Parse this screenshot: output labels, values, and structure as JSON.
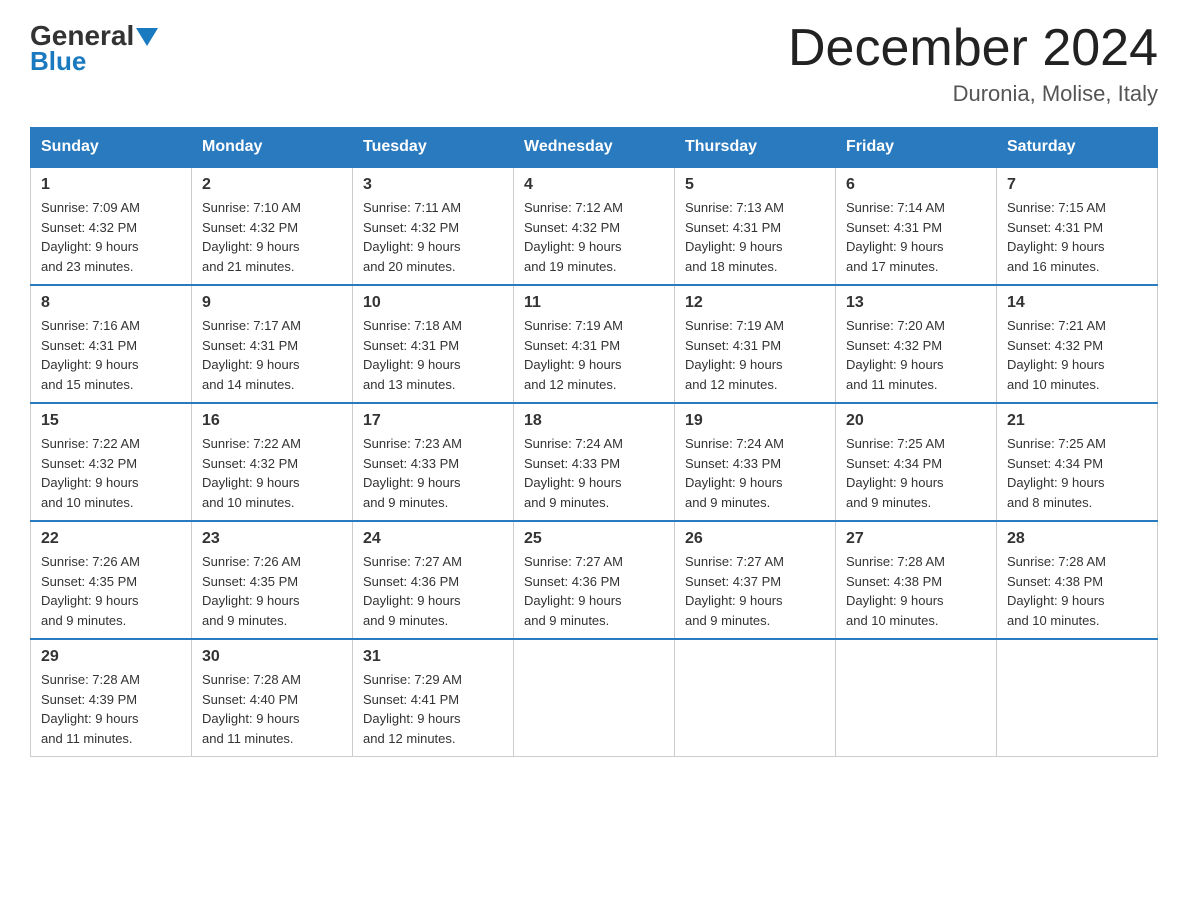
{
  "header": {
    "logo_general": "General",
    "logo_blue": "Blue",
    "month_title": "December 2024",
    "location": "Duronia, Molise, Italy"
  },
  "days_of_week": [
    "Sunday",
    "Monday",
    "Tuesday",
    "Wednesday",
    "Thursday",
    "Friday",
    "Saturday"
  ],
  "weeks": [
    [
      {
        "day": "1",
        "sunrise": "7:09 AM",
        "sunset": "4:32 PM",
        "daylight": "9 hours and 23 minutes."
      },
      {
        "day": "2",
        "sunrise": "7:10 AM",
        "sunset": "4:32 PM",
        "daylight": "9 hours and 21 minutes."
      },
      {
        "day": "3",
        "sunrise": "7:11 AM",
        "sunset": "4:32 PM",
        "daylight": "9 hours and 20 minutes."
      },
      {
        "day": "4",
        "sunrise": "7:12 AM",
        "sunset": "4:32 PM",
        "daylight": "9 hours and 19 minutes."
      },
      {
        "day": "5",
        "sunrise": "7:13 AM",
        "sunset": "4:31 PM",
        "daylight": "9 hours and 18 minutes."
      },
      {
        "day": "6",
        "sunrise": "7:14 AM",
        "sunset": "4:31 PM",
        "daylight": "9 hours and 17 minutes."
      },
      {
        "day": "7",
        "sunrise": "7:15 AM",
        "sunset": "4:31 PM",
        "daylight": "9 hours and 16 minutes."
      }
    ],
    [
      {
        "day": "8",
        "sunrise": "7:16 AM",
        "sunset": "4:31 PM",
        "daylight": "9 hours and 15 minutes."
      },
      {
        "day": "9",
        "sunrise": "7:17 AM",
        "sunset": "4:31 PM",
        "daylight": "9 hours and 14 minutes."
      },
      {
        "day": "10",
        "sunrise": "7:18 AM",
        "sunset": "4:31 PM",
        "daylight": "9 hours and 13 minutes."
      },
      {
        "day": "11",
        "sunrise": "7:19 AM",
        "sunset": "4:31 PM",
        "daylight": "9 hours and 12 minutes."
      },
      {
        "day": "12",
        "sunrise": "7:19 AM",
        "sunset": "4:31 PM",
        "daylight": "9 hours and 12 minutes."
      },
      {
        "day": "13",
        "sunrise": "7:20 AM",
        "sunset": "4:32 PM",
        "daylight": "9 hours and 11 minutes."
      },
      {
        "day": "14",
        "sunrise": "7:21 AM",
        "sunset": "4:32 PM",
        "daylight": "9 hours and 10 minutes."
      }
    ],
    [
      {
        "day": "15",
        "sunrise": "7:22 AM",
        "sunset": "4:32 PM",
        "daylight": "9 hours and 10 minutes."
      },
      {
        "day": "16",
        "sunrise": "7:22 AM",
        "sunset": "4:32 PM",
        "daylight": "9 hours and 10 minutes."
      },
      {
        "day": "17",
        "sunrise": "7:23 AM",
        "sunset": "4:33 PM",
        "daylight": "9 hours and 9 minutes."
      },
      {
        "day": "18",
        "sunrise": "7:24 AM",
        "sunset": "4:33 PM",
        "daylight": "9 hours and 9 minutes."
      },
      {
        "day": "19",
        "sunrise": "7:24 AM",
        "sunset": "4:33 PM",
        "daylight": "9 hours and 9 minutes."
      },
      {
        "day": "20",
        "sunrise": "7:25 AM",
        "sunset": "4:34 PM",
        "daylight": "9 hours and 9 minutes."
      },
      {
        "day": "21",
        "sunrise": "7:25 AM",
        "sunset": "4:34 PM",
        "daylight": "9 hours and 8 minutes."
      }
    ],
    [
      {
        "day": "22",
        "sunrise": "7:26 AM",
        "sunset": "4:35 PM",
        "daylight": "9 hours and 9 minutes."
      },
      {
        "day": "23",
        "sunrise": "7:26 AM",
        "sunset": "4:35 PM",
        "daylight": "9 hours and 9 minutes."
      },
      {
        "day": "24",
        "sunrise": "7:27 AM",
        "sunset": "4:36 PM",
        "daylight": "9 hours and 9 minutes."
      },
      {
        "day": "25",
        "sunrise": "7:27 AM",
        "sunset": "4:36 PM",
        "daylight": "9 hours and 9 minutes."
      },
      {
        "day": "26",
        "sunrise": "7:27 AM",
        "sunset": "4:37 PM",
        "daylight": "9 hours and 9 minutes."
      },
      {
        "day": "27",
        "sunrise": "7:28 AM",
        "sunset": "4:38 PM",
        "daylight": "9 hours and 10 minutes."
      },
      {
        "day": "28",
        "sunrise": "7:28 AM",
        "sunset": "4:38 PM",
        "daylight": "9 hours and 10 minutes."
      }
    ],
    [
      {
        "day": "29",
        "sunrise": "7:28 AM",
        "sunset": "4:39 PM",
        "daylight": "9 hours and 11 minutes."
      },
      {
        "day": "30",
        "sunrise": "7:28 AM",
        "sunset": "4:40 PM",
        "daylight": "9 hours and 11 minutes."
      },
      {
        "day": "31",
        "sunrise": "7:29 AM",
        "sunset": "4:41 PM",
        "daylight": "9 hours and 12 minutes."
      },
      null,
      null,
      null,
      null
    ]
  ],
  "labels": {
    "sunrise": "Sunrise:",
    "sunset": "Sunset:",
    "daylight": "Daylight:"
  }
}
